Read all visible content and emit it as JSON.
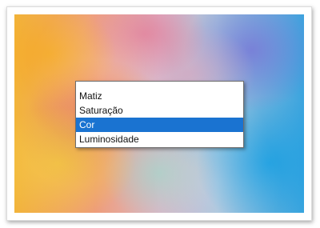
{
  "dropdown": {
    "options": [
      "Matiz",
      "Saturação",
      "Cor",
      "Luminosidade"
    ],
    "selected_index": 2,
    "highlight_color": "#1a73d1"
  },
  "background": {
    "description_colors": [
      "#f2b43a",
      "#ee9d7a",
      "#dcb6c8",
      "#a9c4dc",
      "#3aa4de"
    ]
  }
}
